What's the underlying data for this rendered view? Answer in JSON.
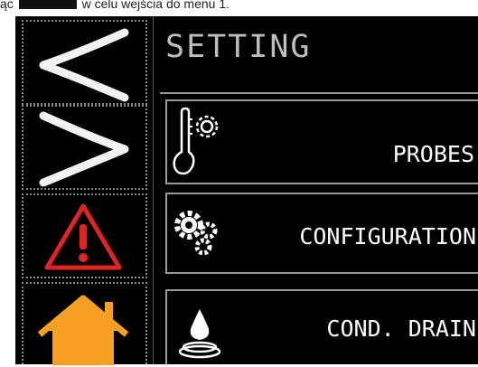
{
  "caption": {
    "prefix": "ąc",
    "suffix": "w celu wejścia do menu 1."
  },
  "screen": {
    "title": "SETTING",
    "sidebar": [
      {
        "name": "previous",
        "icon": "chevron-left-icon"
      },
      {
        "name": "next",
        "icon": "chevron-right-icon"
      },
      {
        "name": "alarm",
        "icon": "warning-triangle-icon"
      },
      {
        "name": "home",
        "icon": "home-icon"
      }
    ],
    "menu": [
      {
        "label": "PROBES",
        "icon": "thermometer-gear-icon"
      },
      {
        "label": "CONFIGURATION",
        "icon": "gears-icon"
      },
      {
        "label": "COND. DRAIN",
        "icon": "water-drop-icon"
      }
    ],
    "colors": {
      "background": "#000000",
      "text": "#ffffff",
      "title": "#bdbdbd",
      "alarm": "#e32222",
      "home": "#f5a020"
    }
  }
}
